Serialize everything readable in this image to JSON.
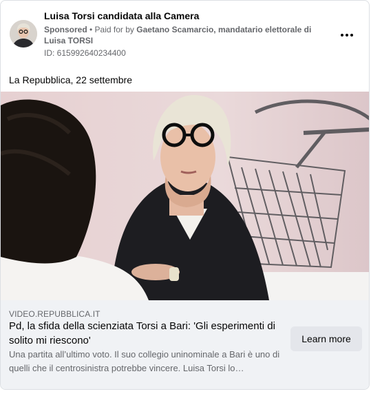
{
  "ad": {
    "page_name": "Luisa Torsi candidata alla Camera",
    "sponsored_label": "Sponsored",
    "separator": " • ",
    "paid_for_prefix": "Paid for by ",
    "paid_for_name": "Gaetano Scamarcio, mandatario elettorale di Luisa TORSI",
    "ad_id": "ID: 615992640234400",
    "caption": "La Repubblica, 22 settembre"
  },
  "link_preview": {
    "domain": "VIDEO.REPUBBLICA.IT",
    "headline": "Pd, la sfida della scienziata Torsi a Bari: 'Gli esperimenti di solito mi riescono'",
    "description": "Una partita all’ultimo voto. Il suo collegio uninominale a Bari è uno di quelli che il centrosinistra potrebbe vincere. Luisa Torsi lo…",
    "cta_label": "Learn more"
  },
  "icons": {
    "more": "more-options-icon"
  },
  "colors": {
    "secondary_text": "#65676b",
    "footer_bg": "#f0f2f5",
    "button_bg": "#e4e6eb"
  }
}
